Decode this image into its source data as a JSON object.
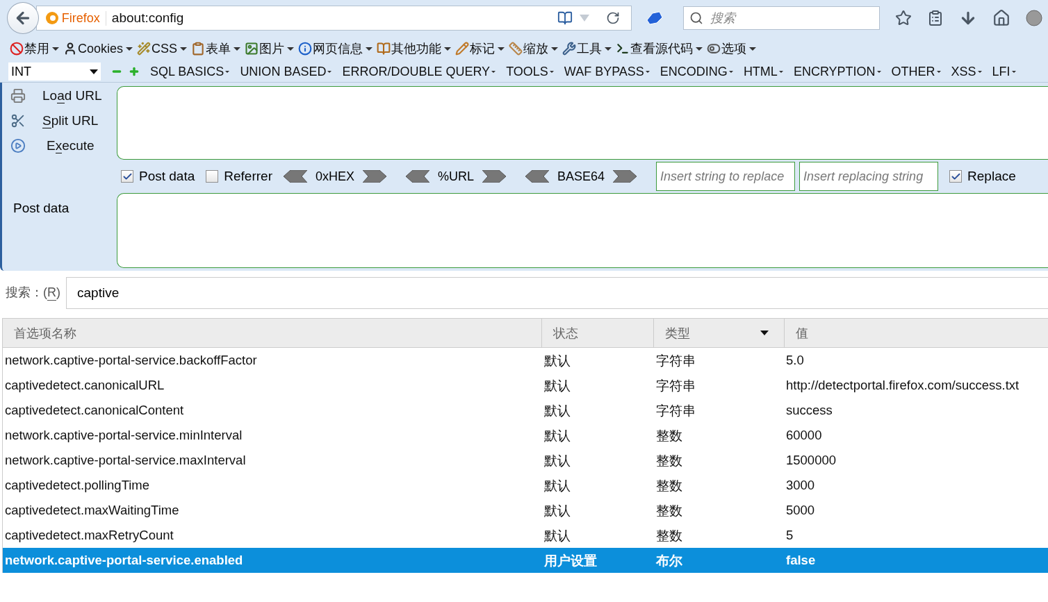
{
  "navbar": {
    "identity": "Firefox",
    "url": "about:config",
    "search_placeholder": "搜索"
  },
  "toolbar": [
    {
      "kind": "block",
      "label": "禁用"
    },
    {
      "kind": "user",
      "label": "Cookies"
    },
    {
      "kind": "wand",
      "label": "CSS"
    },
    {
      "kind": "clipboard",
      "label": "表单"
    },
    {
      "kind": "image",
      "label": "图片"
    },
    {
      "kind": "info",
      "label": "网页信息"
    },
    {
      "kind": "book",
      "label": "其他功能"
    },
    {
      "kind": "pencil",
      "label": "标记"
    },
    {
      "kind": "ruler",
      "label": "缩放"
    },
    {
      "kind": "tools",
      "label": "工具"
    },
    {
      "kind": "terminal",
      "label": "查看源代码"
    },
    {
      "kind": "switch",
      "label": "选项"
    }
  ],
  "hackbar": {
    "type_select": "INT",
    "menus": [
      "SQL BASICS",
      "UNION BASED",
      "ERROR/DOUBLE QUERY",
      "TOOLS",
      "WAF BYPASS",
      "ENCODING",
      "HTML",
      "ENCRYPTION",
      "OTHER",
      "XSS",
      "LFI"
    ],
    "actions": [
      {
        "kind": "load",
        "label_parts": [
          {
            "text": "Lo",
            "underlined": false
          },
          {
            "text": "a",
            "underlined": true
          },
          {
            "text": "d URL",
            "underlined": false
          }
        ]
      },
      {
        "kind": "split",
        "label_parts": [
          {
            "text": "S",
            "underlined": true
          },
          {
            "text": "plit URL",
            "underlined": false
          }
        ]
      },
      {
        "kind": "execute",
        "label_parts": [
          {
            "text": "E",
            "underlined": false
          },
          {
            "text": "x",
            "underlined": true
          },
          {
            "text": "ecute",
            "underlined": false
          }
        ]
      }
    ],
    "options": [
      {
        "kind": "checkbox",
        "label": "Post data",
        "checked": true
      },
      {
        "kind": "checkbox",
        "label": "Referrer",
        "checked": false
      },
      {
        "kind": "encoder",
        "label": "0xHEX"
      },
      {
        "kind": "encoder",
        "label": "%URL"
      },
      {
        "kind": "encoder",
        "label": "BASE64"
      },
      {
        "kind": "field",
        "placeholder": "Insert string to replace"
      },
      {
        "kind": "field",
        "placeholder": "Insert replacing string"
      },
      {
        "kind": "checkbox",
        "label": "Replace",
        "checked": true
      }
    ],
    "post_data_label": "Post data"
  },
  "search": {
    "label_parts": [
      {
        "text": "搜索：(",
        "underlined": false
      },
      {
        "text": "R",
        "underlined": true
      },
      {
        "text": ")",
        "underlined": false
      }
    ],
    "value": "captive"
  },
  "table": {
    "columns": [
      "首选项名称",
      "状态",
      "类型",
      "值"
    ],
    "rows": [
      {
        "name": "network.captive-portal-service.backoffFactor",
        "status": "默认",
        "type": "字符串",
        "value": "5.0",
        "modified": false,
        "selected": false
      },
      {
        "name": "captivedetect.canonicalURL",
        "status": "默认",
        "type": "字符串",
        "value": "http://detectportal.firefox.com/success.txt",
        "modified": false,
        "selected": false
      },
      {
        "name": "captivedetect.canonicalContent",
        "status": "默认",
        "type": "字符串",
        "value": "success",
        "modified": false,
        "selected": false
      },
      {
        "name": "network.captive-portal-service.minInterval",
        "status": "默认",
        "type": "整数",
        "value": "60000",
        "modified": false,
        "selected": false
      },
      {
        "name": "network.captive-portal-service.maxInterval",
        "status": "默认",
        "type": "整数",
        "value": "1500000",
        "modified": false,
        "selected": false
      },
      {
        "name": "captivedetect.pollingTime",
        "status": "默认",
        "type": "整数",
        "value": "3000",
        "modified": false,
        "selected": false
      },
      {
        "name": "captivedetect.maxWaitingTime",
        "status": "默认",
        "type": "整数",
        "value": "5000",
        "modified": false,
        "selected": false
      },
      {
        "name": "captivedetect.maxRetryCount",
        "status": "默认",
        "type": "整数",
        "value": "5",
        "modified": false,
        "selected": false
      },
      {
        "name": "network.captive-portal-service.enabled",
        "status": "用户设置",
        "type": "布尔",
        "value": "false",
        "modified": true,
        "selected": true
      }
    ]
  }
}
